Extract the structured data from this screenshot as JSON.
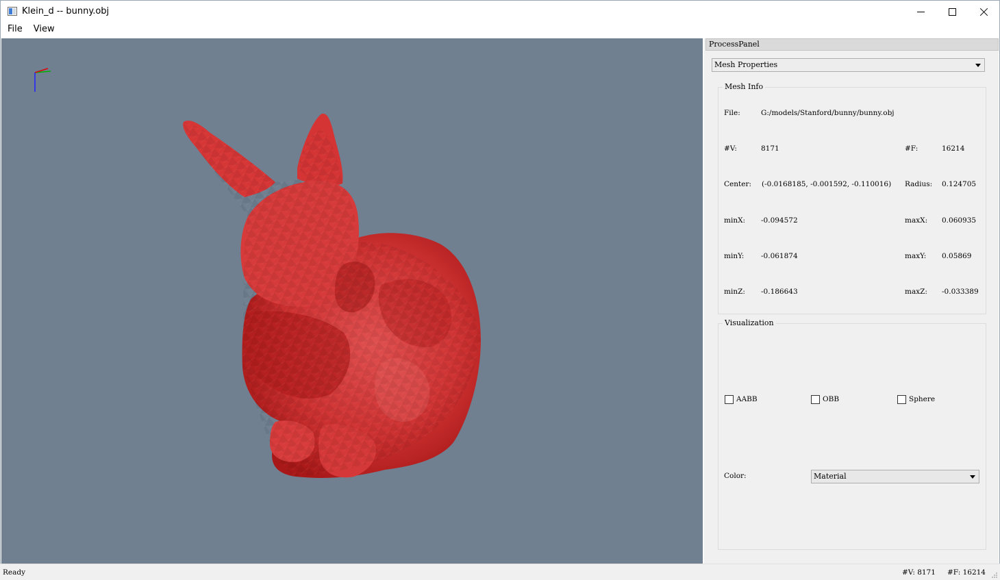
{
  "window": {
    "title": "Klein_d -- bunny.obj",
    "icon": "app-window-icon"
  },
  "menu": {
    "items": [
      "File",
      "View"
    ]
  },
  "viewport": {
    "background": "#708090",
    "mesh_color": "#d83a3a",
    "axes": {
      "x_color": "#ff0000",
      "y_color": "#00b000",
      "z_color": "#0000ff"
    }
  },
  "panel": {
    "title": "ProcessPanel",
    "mode_select": "Mesh Properties",
    "mesh_info": {
      "group_label": "Mesh Info",
      "file_label": "File:",
      "file_value": "G:/models/Stanford/bunny/bunny.obj",
      "v_label": "#V:",
      "v_value": "8171",
      "f_label": "#F:",
      "f_value": "16214",
      "center_label": "Center:",
      "center_value": "(-0.0168185, -0.001592, -0.110016)",
      "radius_label": "Radius:",
      "radius_value": "0.124705",
      "minx_label": "minX:",
      "minx_value": "-0.094572",
      "maxx_label": "maxX:",
      "maxx_value": "0.060935",
      "miny_label": "minY:",
      "miny_value": "-0.061874",
      "maxy_label": "maxY:",
      "maxy_value": "0.05869",
      "minz_label": "minZ:",
      "minz_value": "-0.186643",
      "maxz_label": "maxZ:",
      "maxz_value": "-0.033389"
    },
    "visualization": {
      "group_label": "Visualization",
      "checkboxes": [
        {
          "label": "AABB",
          "checked": false
        },
        {
          "label": "OBB",
          "checked": false
        },
        {
          "label": "Sphere",
          "checked": false
        }
      ],
      "color_label": "Color:",
      "color_value": "Material"
    }
  },
  "status": {
    "left": "Ready",
    "v": "#V: 8171",
    "f": "#F: 16214"
  }
}
